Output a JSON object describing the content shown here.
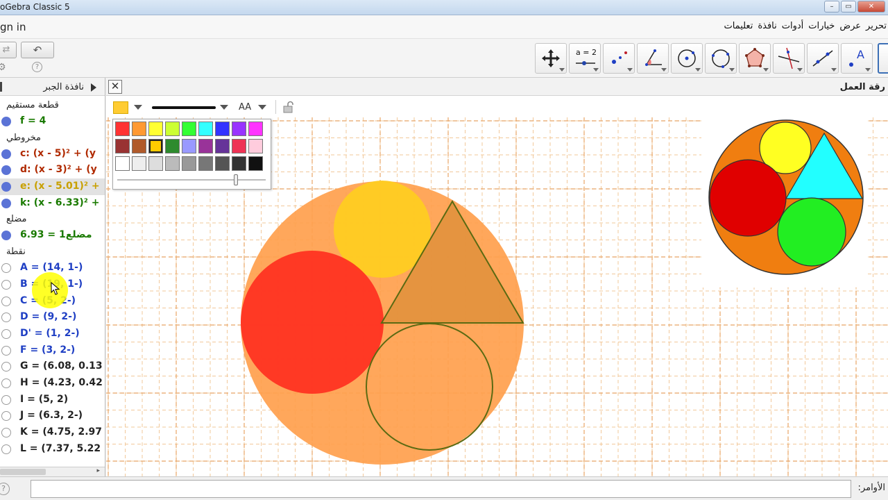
{
  "window": {
    "title": "oGebra Classic 5",
    "buttons": [
      "–",
      "▭",
      "✕"
    ]
  },
  "menubar": {
    "sign_in": "gn in",
    "items": [
      "تحرير",
      "عرض",
      "خيارات",
      "أدوات",
      "نافذة",
      "تعليمات"
    ]
  },
  "toolbar": {
    "undo": "↶",
    "redo": "⇄",
    "help": "?",
    "tools": [
      {
        "name": "move",
        "label": ""
      },
      {
        "name": "slider",
        "label": "a = 2"
      },
      {
        "name": "point",
        "label": ""
      },
      {
        "name": "angle",
        "label": ""
      },
      {
        "name": "circle-center-point",
        "label": ""
      },
      {
        "name": "circle-three-points",
        "label": ""
      },
      {
        "name": "polygon",
        "label": ""
      },
      {
        "name": "perpendicular-line",
        "label": ""
      },
      {
        "name": "line",
        "label": ""
      },
      {
        "name": "text",
        "label": "A"
      },
      {
        "name": "graphics-view-toggle",
        "label": ""
      }
    ]
  },
  "algebra": {
    "title": "نافذة الجبر",
    "groups": [
      {
        "category": "قطعة مستقيم",
        "items": [
          {
            "text": "f = 4",
            "color": "#1a7a00",
            "visible": true
          }
        ]
      },
      {
        "category": "مخروطي",
        "items": [
          {
            "text": "c: (x - 5)² + (y",
            "color": "#b02a00",
            "visible": true
          },
          {
            "text": "d: (x - 3)² + (y",
            "color": "#b02a00",
            "visible": true
          },
          {
            "text": "e: (x - 5.01)² +",
            "color": "#c8a000",
            "visible": true,
            "highlight": true
          },
          {
            "text": "k: (x - 6.33)² +",
            "color": "#1a7a00",
            "visible": true
          }
        ]
      },
      {
        "category": "مضلع",
        "items": [
          {
            "text": "مضلع1 = 6.93",
            "color": "#1a7a00",
            "visible": true
          }
        ]
      },
      {
        "category": "نقطة",
        "items": [
          {
            "text": "A = (14, 1-)",
            "color": "#1f3fc4",
            "visible": false
          },
          {
            "text": "B = (19, 1-)",
            "color": "#1f3fc4",
            "visible": false
          },
          {
            "text": "C = (5, 2-)",
            "color": "#1f3fc4",
            "visible": false
          },
          {
            "text": "D = (9, 2-)",
            "color": "#1f3fc4",
            "visible": false
          },
          {
            "text": "D' = (1, 2-)",
            "color": "#1f3fc4",
            "visible": false
          },
          {
            "text": "F = (3, 2-)",
            "color": "#1f3fc4",
            "visible": false
          },
          {
            "text": "G = (6.08, 0.13",
            "color": "#222222",
            "visible": false
          },
          {
            "text": "H = (4.23, 0.42",
            "color": "#222222",
            "visible": false
          },
          {
            "text": "I = (5, 2)",
            "color": "#222222",
            "visible": false
          },
          {
            "text": "J = (6.3, 2-)",
            "color": "#222222",
            "visible": false
          },
          {
            "text": "K = (4.75, 2.97",
            "color": "#222222",
            "visible": false
          },
          {
            "text": "L = (7.37, 5.22",
            "color": "#222222",
            "visible": false
          }
        ]
      }
    ]
  },
  "graphics": {
    "title": "رقة العمل",
    "close": "✕",
    "stylebar": {
      "fill_color": "#ffcc33",
      "text_size": "AA"
    },
    "palette": {
      "rows": [
        [
          "#ff3333",
          "#ff9933",
          "#ffff33",
          "#ccff33",
          "#33ff33",
          "#33ffff",
          "#3333ff",
          "#9933ff",
          "#ff33ff"
        ],
        [
          "#993333",
          "#b05a2a",
          "#ffcc00",
          "#2e8b2e",
          "#9999ff",
          "#993399",
          "#663399",
          "#ee3355",
          "#ffccdd"
        ],
        [
          "#ffffff",
          "#eeeeee",
          "#dddddd",
          "#bbbbbb",
          "#999999",
          "#777777",
          "#555555",
          "#333333",
          "#111111"
        ]
      ],
      "selected": [
        1,
        2
      ],
      "opacity": 0.77
    },
    "grid": {
      "minor_color": "#f2c89a",
      "major_color": "#e8a566"
    },
    "colors": {
      "big_disc": "#ffa04d",
      "yellow_disc": "#ffcc22",
      "red_disc": "#ff3322",
      "triangle": "#e0903c",
      "outline": "#5a6a12",
      "ref_orange": "#f07e10",
      "ref_yellow": "#ffff22",
      "ref_red": "#e00000",
      "ref_cyan": "#22ffff",
      "ref_green": "#22ee22"
    }
  },
  "inputbar": {
    "label": ":الأوامر",
    "value": "",
    "placeholder": ""
  }
}
